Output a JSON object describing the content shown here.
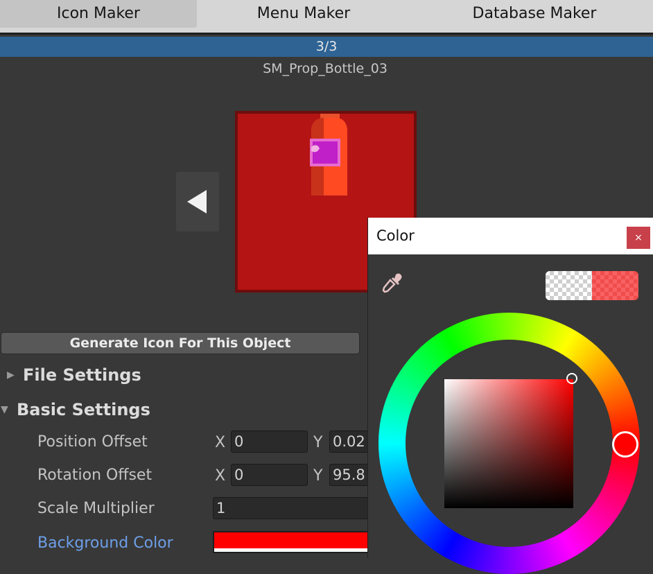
{
  "tabs": [
    {
      "label": "Icon Maker",
      "active": true
    },
    {
      "label": "Menu Maker",
      "active": false
    },
    {
      "label": "Database Maker",
      "active": false
    }
  ],
  "progress": {
    "text": "3/3",
    "value": 1.0,
    "color": "#2e6394"
  },
  "object_name": "SM_Prop_Bottle_03",
  "preview": {
    "background_color": "#b41414",
    "prev_icon": "triangle-left-icon"
  },
  "generate_button": "Generate Icon For This Object",
  "sections": {
    "file_settings": {
      "label": "File Settings",
      "expanded": false
    },
    "basic_settings": {
      "label": "Basic Settings",
      "expanded": true
    }
  },
  "basic": {
    "position_offset": {
      "label": "Position Offset",
      "x_label": "X",
      "x": "0",
      "y_label": "Y",
      "y": "0.02"
    },
    "rotation_offset": {
      "label": "Rotation Offset",
      "x_label": "X",
      "x": "0",
      "y_label": "Y",
      "y": "95.8"
    },
    "scale_multiplier": {
      "label": "Scale Multiplier",
      "value": "1"
    },
    "background_color": {
      "label": "Background Color",
      "value": "#ff0000"
    }
  },
  "color_picker": {
    "title": "Color",
    "close_label": "×",
    "eyedropper_icon": "eyedropper-icon",
    "previous_color": "transparent",
    "current_color": "#f04c4c",
    "hue": "#ff0000"
  }
}
